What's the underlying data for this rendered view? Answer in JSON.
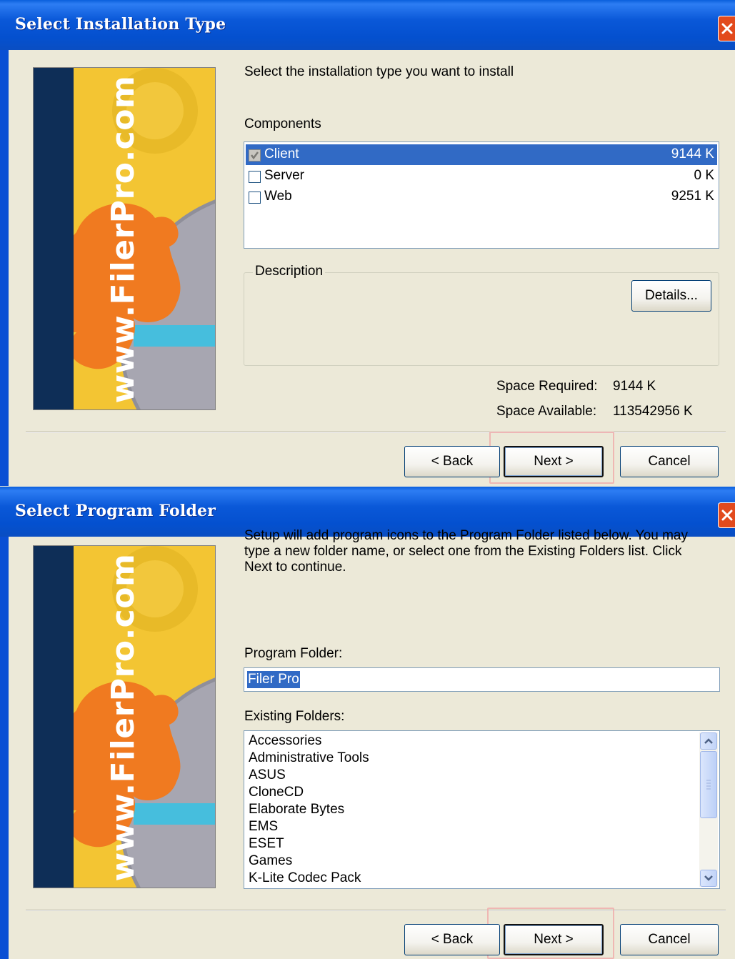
{
  "dialog1": {
    "title": "Select Installation Type",
    "banner_text": "www.FilerPro.com",
    "instruction": "Select the installation type you want to install",
    "components_label": "Components",
    "components": [
      {
        "name": "Client",
        "size": "9144 K",
        "checked": true,
        "selected": true
      },
      {
        "name": "Server",
        "size": "0 K",
        "checked": false,
        "selected": false
      },
      {
        "name": "Web",
        "size": "9251 K",
        "checked": false,
        "selected": false
      }
    ],
    "description_label": "Description",
    "details_button": "Details...",
    "space_required_label": "Space Required:",
    "space_required_value": "9144 K",
    "space_available_label": "Space Available:",
    "space_available_value": "113542956 K",
    "back_button": "< Back",
    "next_button": "Next >",
    "cancel_button": "Cancel"
  },
  "dialog2": {
    "title": "Select Program Folder",
    "banner_text": "www.FilerPro.com",
    "instruction_lines": [
      "Setup will add program icons to the Program Folder listed below. You may",
      "type a new folder name, or select one from the Existing Folders list. Click",
      "Next to continue."
    ],
    "program_folder_label": "Program Folder:",
    "program_folder_value": "Filer Pro",
    "existing_folders_label": "Existing Folders:",
    "existing_folders": [
      "Accessories",
      "Administrative Tools",
      "ASUS",
      "CloneCD",
      "Elaborate Bytes",
      "EMS",
      "ESET",
      "Games",
      "K-Lite Codec Pack"
    ],
    "back_button": "< Back",
    "next_button": "Next >",
    "cancel_button": "Cancel"
  },
  "colors": {
    "titlebar": "#0a58d8",
    "selection": "#316ac5",
    "dialog_bg": "#ece9d8",
    "close_button": "#e24a1d",
    "highlight_box": "#f0aaaa"
  }
}
